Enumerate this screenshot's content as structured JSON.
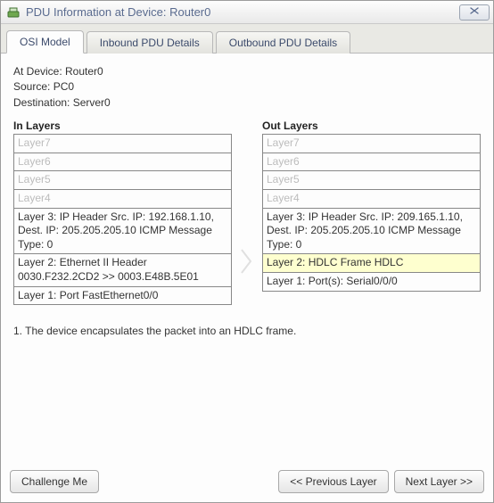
{
  "window": {
    "title": "PDU Information at Device: Router0"
  },
  "tabs": [
    {
      "label": "OSI Model",
      "active": true
    },
    {
      "label": "Inbound PDU Details",
      "active": false
    },
    {
      "label": "Outbound PDU Details",
      "active": false
    }
  ],
  "device_info": {
    "at_device": "At Device: Router0",
    "source": "Source: PC0",
    "destination": "Destination: Server0"
  },
  "in_layers": {
    "heading": "In Layers",
    "layers": [
      {
        "text": "Layer7",
        "active": false
      },
      {
        "text": "Layer6",
        "active": false
      },
      {
        "text": "Layer5",
        "active": false
      },
      {
        "text": "Layer4",
        "active": false
      },
      {
        "text": "Layer 3: IP Header Src. IP: 192.168.1.10, Dest. IP: 205.205.205.10 ICMP Message Type: 0",
        "active": true
      },
      {
        "text": "Layer 2: Ethernet II Header 0030.F232.2CD2 >> 0003.E48B.5E01",
        "active": true
      },
      {
        "text": "Layer 1: Port FastEthernet0/0",
        "active": true
      }
    ]
  },
  "out_layers": {
    "heading": "Out Layers",
    "layers": [
      {
        "text": "Layer7",
        "active": false
      },
      {
        "text": "Layer6",
        "active": false
      },
      {
        "text": "Layer5",
        "active": false
      },
      {
        "text": "Layer4",
        "active": false
      },
      {
        "text": "Layer 3: IP Header Src. IP: 209.165.1.10, Dest. IP: 205.205.205.10 ICMP Message Type: 0",
        "active": true
      },
      {
        "text": "Layer 2: HDLC Frame HDLC",
        "active": true,
        "highlight": true
      },
      {
        "text": "Layer 1: Port(s): Serial0/0/0",
        "active": true
      }
    ]
  },
  "explanation": "1. The device encapsulates the packet into an HDLC frame.",
  "buttons": {
    "challenge": "Challenge Me",
    "prev": "<< Previous Layer",
    "next": "Next Layer >>"
  }
}
